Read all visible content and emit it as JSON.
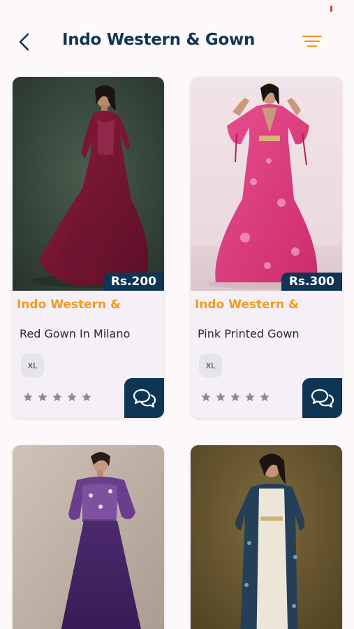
{
  "header": {
    "title": "Indo Western & Gown",
    "back_icon": "chevron-left-icon",
    "filter_icon": "filter-lines-icon"
  },
  "colors": {
    "brand_navy": "#0f3554",
    "accent_orange": "#f39a1f",
    "star_gray": "#8c8c8c",
    "background": "#fdf8fa"
  },
  "products": [
    {
      "price": "Rs.200",
      "category": "Indo Western &",
      "name": "Red Gown In Milano",
      "size": "XL",
      "rating": 0,
      "max_rating": 5,
      "chat_icon": "chat-bubbles-icon"
    },
    {
      "price": "Rs.300",
      "category": "Indo Western &",
      "name": "Pink Printed Gown",
      "size": "XL",
      "rating": 0,
      "max_rating": 5,
      "chat_icon": "chat-bubbles-icon"
    },
    {
      "price": "",
      "category": "",
      "name": "",
      "size": "",
      "rating": 0,
      "max_rating": 5
    },
    {
      "price": "",
      "category": "",
      "name": "",
      "size": "",
      "rating": 0,
      "max_rating": 5
    }
  ]
}
